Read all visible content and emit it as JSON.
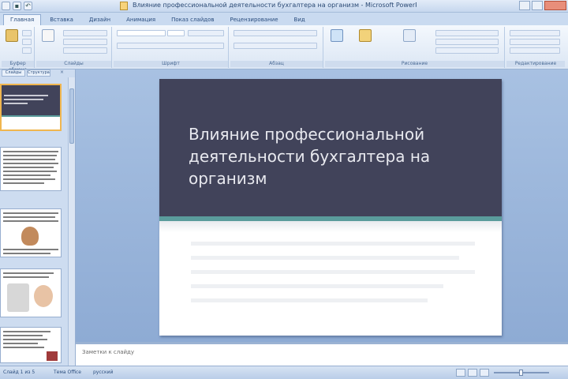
{
  "titlebar": {
    "title": "Влияние профессиональной деятельности бухгалтера на организм - Microsoft PowerPoint"
  },
  "ribbon_tabs": [
    "Главная",
    "Вставка",
    "Дизайн",
    "Анимация",
    "Показ слайдов",
    "Рецензирование",
    "Вид"
  ],
  "ribbon_groups": [
    "Буфер обмена",
    "Слайды",
    "Шрифт",
    "Абзац",
    "Рисование",
    "Редактирование"
  ],
  "left_pane": {
    "tab_slides": "Слайды",
    "tab_outline": "Структура",
    "selected_slide": 1
  },
  "slide": {
    "title": "Влияние профессиональной деятельности бухгалтера на организм"
  },
  "notes": {
    "placeholder": "Заметки к слайду"
  },
  "status": {
    "slide_counter": "Слайд 1 из 5",
    "theme": "Тема Office",
    "language": "русский"
  },
  "colors": {
    "slide_header": "#41435a",
    "accent_stripe": "#5a9c9c",
    "selected_thumb_border": "#f0b64f"
  }
}
